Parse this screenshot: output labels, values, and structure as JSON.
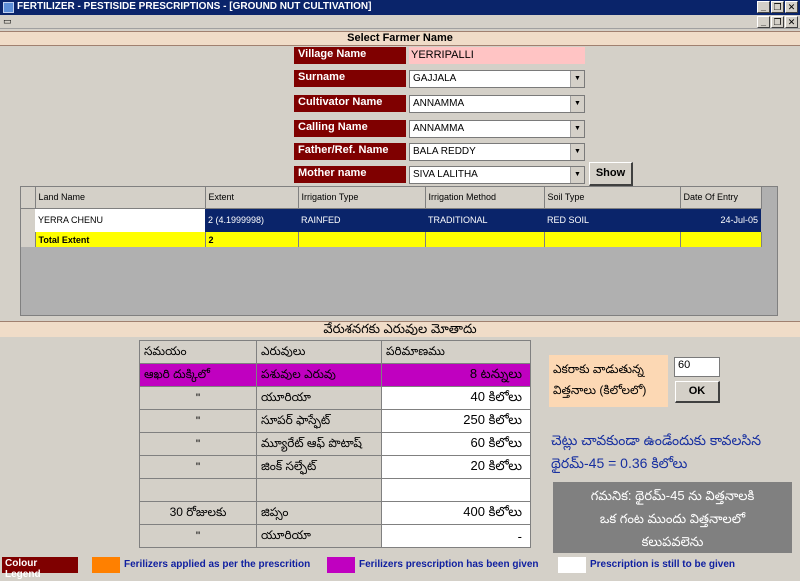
{
  "window": {
    "title": "FERTILIZER - PESTISIDE PRESCRIPTIONS - [GROUND NUT CULTIVATION]",
    "min_glyph": "_",
    "max_glyph": "❐",
    "close_glyph": "✕"
  },
  "menubar": {
    "icon_glyph": "▭"
  },
  "farmer_header": "Select Farmer Name",
  "form": {
    "village_label": "Village Name",
    "village_value": "YERRIPALLI",
    "surname_label": "Surname",
    "surname_value": "GAJJALA",
    "cultivator_label": "Cultivator Name",
    "cultivator_value": "ANNAMMA",
    "calling_label": "Calling Name",
    "calling_value": "ANNAMMA",
    "father_label": "Father/Ref. Name",
    "father_value": "BALA REDDY",
    "mother_label": "Mother name",
    "mother_value": "SIVA LALITHA",
    "show_button": "Show",
    "dropdown_glyph": "▼"
  },
  "land_grid": {
    "columns": [
      "Land Name",
      "Extent",
      "Irrigation Type",
      "Irrigation Method",
      "Soil Type",
      "Date Of Entry"
    ],
    "row": {
      "land_name": "YERRA CHENU",
      "extent": "2 (4.1999998)",
      "irrigation_type": "RAINFED",
      "irrigation_method": "TRADITIONAL",
      "soil_type": "RED SOIL",
      "date_of_entry": "24-Jul-05"
    },
    "total_label": "Total Extent",
    "total_value": "2"
  },
  "totals_header": "వేరుశనగకు ఎరువుల మోతాదు",
  "prescription": {
    "headers": [
      "సమయం",
      "ఎరువులు",
      "పరిమాణము"
    ],
    "rows": [
      {
        "time": "ఆఖరి దుక్కిలో",
        "fertilizer": "పశువుల ఎరువు",
        "amount": "8   టన్నులు",
        "state": "given"
      },
      {
        "time": "\"",
        "fertilizer": "యూరియా",
        "amount": "40 కిలోలు",
        "state": "pending"
      },
      {
        "time": "\"",
        "fertilizer": "సూపర్ ఫాస్ఫేట్",
        "amount": "250 కిలోలు",
        "state": "pending"
      },
      {
        "time": "\"",
        "fertilizer": "మ్యూరేట్ ఆఫ్ పొటాష్",
        "amount": "60 కిలోలు",
        "state": "pending"
      },
      {
        "time": "\"",
        "fertilizer": "జింక్ సల్ఫేట్",
        "amount": "20 కిలోలు",
        "state": "pending"
      },
      {
        "time": "",
        "fertilizer": "",
        "amount": "",
        "state": "pending"
      },
      {
        "time": "30 రోజులకు",
        "fertilizer": "జిప్సం",
        "amount": "400 కిలోలు",
        "state": "pending"
      },
      {
        "time": "\"",
        "fertilizer": "యూరియా",
        "amount": "-",
        "state": "pending"
      }
    ]
  },
  "per_acre": {
    "label": "ఎకరాకు వాడుతున్న విత్తనాలు (కిలోలలో)",
    "value": "60",
    "ok_button": "OK"
  },
  "blue_note": {
    "line1": "చెట్లు చావకుండా ఉండేందుకు కావలసిన",
    "line2": "థైరమ్-45 = 0.36 కిలోలు"
  },
  "grey_note": {
    "line1": "గమనిక: థైరమ్-45 ను విత్తనాలకి",
    "line2": "ఒక గంట ముందు విత్తనాలలో",
    "line3": "కలుపవలెను"
  },
  "legend": {
    "title": "Colour Legend",
    "item1": "Ferilizers applied as per the prescrition",
    "item2": "Ferilizers prescription has been given",
    "item3": "Prescription is still to be given",
    "colors": {
      "applied": "#ff8000",
      "given": "#c000c0",
      "pending": "#ffffff"
    }
  }
}
